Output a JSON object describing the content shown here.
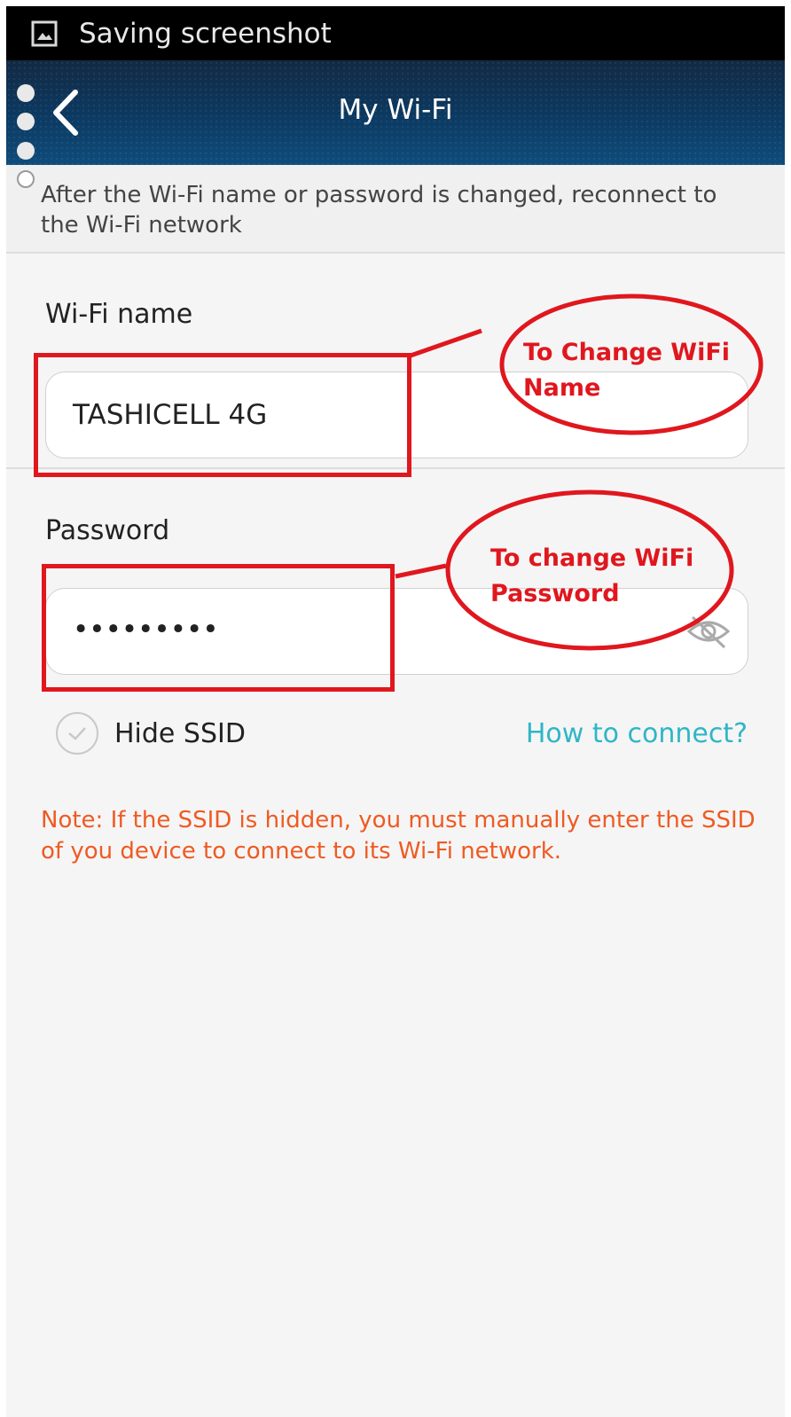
{
  "status_bar": {
    "text": "Saving screenshot",
    "icon": "image-icon"
  },
  "header": {
    "title": "My Wi-Fi",
    "back_icon": "chevron-left-icon"
  },
  "banner": {
    "text": "After the Wi-Fi name or password is changed, reconnect to the Wi-Fi network"
  },
  "wifi_name": {
    "label": "Wi-Fi name",
    "value": "TASHICELL 4G"
  },
  "password": {
    "label": "Password",
    "value": "•••••••••",
    "visibility_icon": "eye-off-icon"
  },
  "hide_ssid": {
    "label": "Hide SSID",
    "checked": false
  },
  "how_to_connect": {
    "label": "How to connect?"
  },
  "note": {
    "text": "Note: If the SSID is hidden, you must manually enter the SSID of you device to connect to its Wi-Fi network."
  },
  "annotations": {
    "name_callout": {
      "line1": "To Change WiFi",
      "line2": "Name"
    },
    "password_callout": {
      "line1": "To change WiFi",
      "line2": "Password"
    }
  },
  "colors": {
    "accent_link": "#2fb6c6",
    "note": "#ef5a22",
    "annotation": "#e0171e",
    "header": "#0d3b63"
  }
}
